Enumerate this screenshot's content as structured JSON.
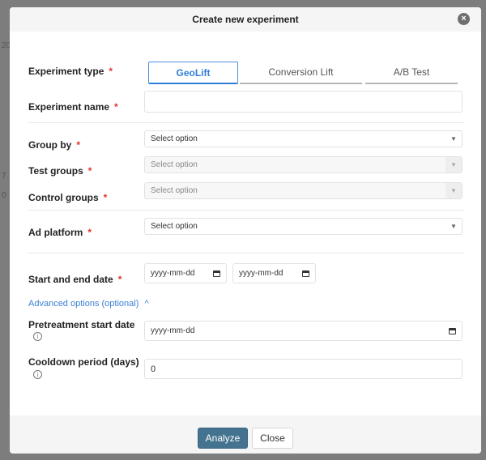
{
  "modal": {
    "title": "Create new experiment",
    "close_icon": "×"
  },
  "backdrop": [
    "20",
    "7",
    "0"
  ],
  "experiment_type": {
    "label": "Experiment type",
    "tabs": [
      "GeoLift",
      "Conversion Lift",
      "A/B Test"
    ],
    "selected": "GeoLift"
  },
  "experiment_name": {
    "label": "Experiment name",
    "value": ""
  },
  "group_by": {
    "label": "Group by",
    "value": "Select option"
  },
  "test_groups": {
    "label": "Test groups",
    "value": "Select option"
  },
  "control_groups": {
    "label": "Control groups",
    "value": "Select option"
  },
  "ad_platform": {
    "label": "Ad platform",
    "value": "Select option"
  },
  "dates": {
    "label": "Start and end date",
    "start": "yyyy-mm-dd",
    "end": "yyyy-mm-dd"
  },
  "advanced": {
    "label": "Advanced options (optional)",
    "chevron": "^"
  },
  "pretreatment": {
    "label": "Pretreatment start date",
    "value": "yyyy-mm-dd"
  },
  "cooldown": {
    "label": "Cooldown period (days)",
    "value": "0"
  },
  "required_mark": "*",
  "info_mark": "i",
  "caret": "▼",
  "footer": {
    "analyze_label": "Analyze",
    "close_label": "Close"
  },
  "colors": {
    "accent": "#2f7fd8",
    "primary_button": "#44738f",
    "required": "#e0342b"
  }
}
